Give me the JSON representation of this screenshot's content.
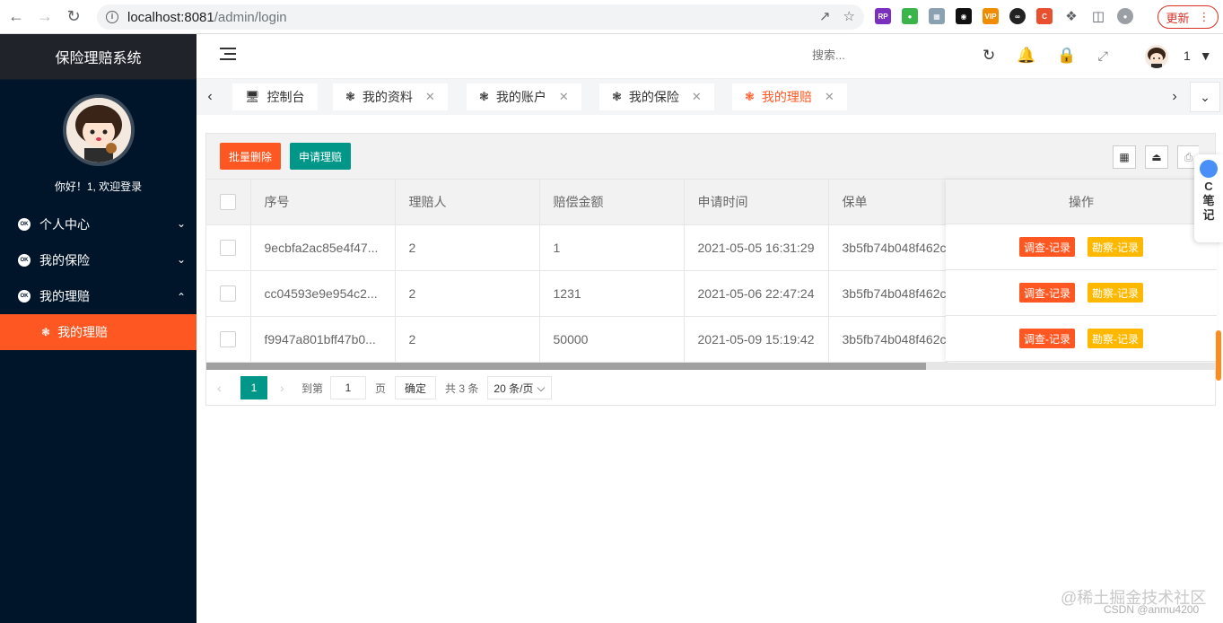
{
  "browser": {
    "url_host": "localhost:8081",
    "url_path": "/admin/login",
    "update_label": "更新"
  },
  "sidebar": {
    "title": "保险理赔系统",
    "welcome": "你好！1, 欢迎登录",
    "items": [
      {
        "label": "个人中心",
        "icon": "ok-icon",
        "chevron": "down"
      },
      {
        "label": "我的保险",
        "icon": "ok-icon",
        "chevron": "down"
      },
      {
        "label": "我的理赔",
        "icon": "ok-icon",
        "chevron": "up"
      }
    ],
    "sub_items": [
      {
        "label": "我的理赔",
        "active": true
      }
    ],
    "colors": {
      "bg": "#001529",
      "active": "#ff5722"
    }
  },
  "header": {
    "search_placeholder": "搜索...",
    "user_name": "1"
  },
  "tabs": [
    {
      "label": "控制台",
      "icon": "monitor-icon",
      "closable": false,
      "active": false
    },
    {
      "label": "我的资料",
      "icon": "palm-icon",
      "closable": true,
      "active": false
    },
    {
      "label": "我的账户",
      "icon": "palm-icon",
      "closable": true,
      "active": false
    },
    {
      "label": "我的保险",
      "icon": "palm-icon",
      "closable": true,
      "active": false
    },
    {
      "label": "我的理赔",
      "icon": "palm-icon",
      "closable": true,
      "active": true
    }
  ],
  "toolbar": {
    "batch_delete": "批量删除",
    "apply_claim": "申请理赔"
  },
  "table": {
    "columns": [
      "序号",
      "理赔人",
      "赔偿金额",
      "申请时间",
      "保单",
      "操作"
    ],
    "rows": [
      {
        "id": "9ecbfa2ac85e4f47...",
        "claimant": "2",
        "amount": "1",
        "time": "2021-05-05 16:31:29",
        "policy": "3b5fb74b048f462c"
      },
      {
        "id": "cc04593e9e954c2...",
        "claimant": "2",
        "amount": "1231",
        "time": "2021-05-06 22:47:24",
        "policy": "3b5fb74b048f462c"
      },
      {
        "id": "f9947a801bff47b0...",
        "claimant": "2",
        "amount": "50000",
        "time": "2021-05-09 15:19:42",
        "policy": "3b5fb74b048f462c"
      }
    ],
    "op_survey": "调查-记录",
    "op_inspect": "勘察-记录"
  },
  "pager": {
    "current": "1",
    "goto_label": "到第",
    "goto_value": "1",
    "page_unit": "页",
    "confirm": "确定",
    "total": "共 3 条",
    "page_size": "20 条/页"
  },
  "note_widget": {
    "c": "C",
    "line1": "笔",
    "line2": "记"
  },
  "watermark": {
    "line1": "@稀土掘金技术社区",
    "line2": "CSDN @anmu4200"
  }
}
